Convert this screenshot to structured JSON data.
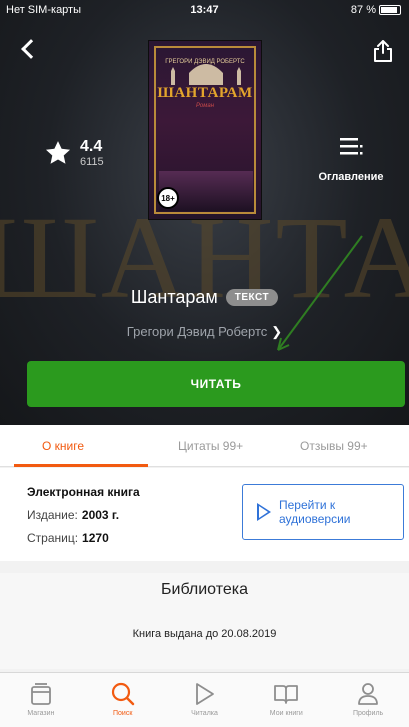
{
  "status_bar": {
    "carrier": "Нет SIM-карты",
    "time": "13:47",
    "battery": "87 %"
  },
  "hero": {
    "background_word": "ШАНТАРАМ",
    "rating": {
      "value": "4.4",
      "count": "6115"
    },
    "toc_label": "Оглавление",
    "cover": {
      "author": "ГРЕГОРИ ДЭВИД РОБЕРТС",
      "title": "ШАНТАРАМ",
      "subtitle": "Роман",
      "age_rating": "18+"
    },
    "book_title": "Шантарам",
    "format_badge": "ТЕКСТ",
    "author": "Грегори Дэвид Робертс",
    "read_button": "ЧИТАТЬ"
  },
  "tabs": [
    {
      "label": "О книге",
      "active": true
    },
    {
      "label": "Цитаты 99+",
      "active": false
    },
    {
      "label": "Отзывы 99+",
      "active": false
    }
  ],
  "info": {
    "type": "Электронная книга",
    "edition_label": "Издание:",
    "edition_value": "2003 г.",
    "pages_label": "Страниц:",
    "pages_value": "1270",
    "audio_button_line1": "Перейти к",
    "audio_button_line2": "аудиоверсии"
  },
  "library": {
    "header": "Библиотека",
    "issued": "Книга выдана до 20.08.2019"
  },
  "tabbar": [
    {
      "label": "Магазин",
      "icon": "store-icon",
      "active": false
    },
    {
      "label": "Поиск",
      "icon": "search-icon",
      "active": true
    },
    {
      "label": "Читалка",
      "icon": "play-icon",
      "active": false
    },
    {
      "label": "Мои книги",
      "icon": "open-book-icon",
      "active": false
    },
    {
      "label": "Профиль",
      "icon": "profile-icon",
      "active": false
    }
  ],
  "colors": {
    "accent": "#f25a10",
    "read_button": "#2b9a1e",
    "link": "#2f72d8",
    "annotation_arrow": "#2f7d22"
  }
}
